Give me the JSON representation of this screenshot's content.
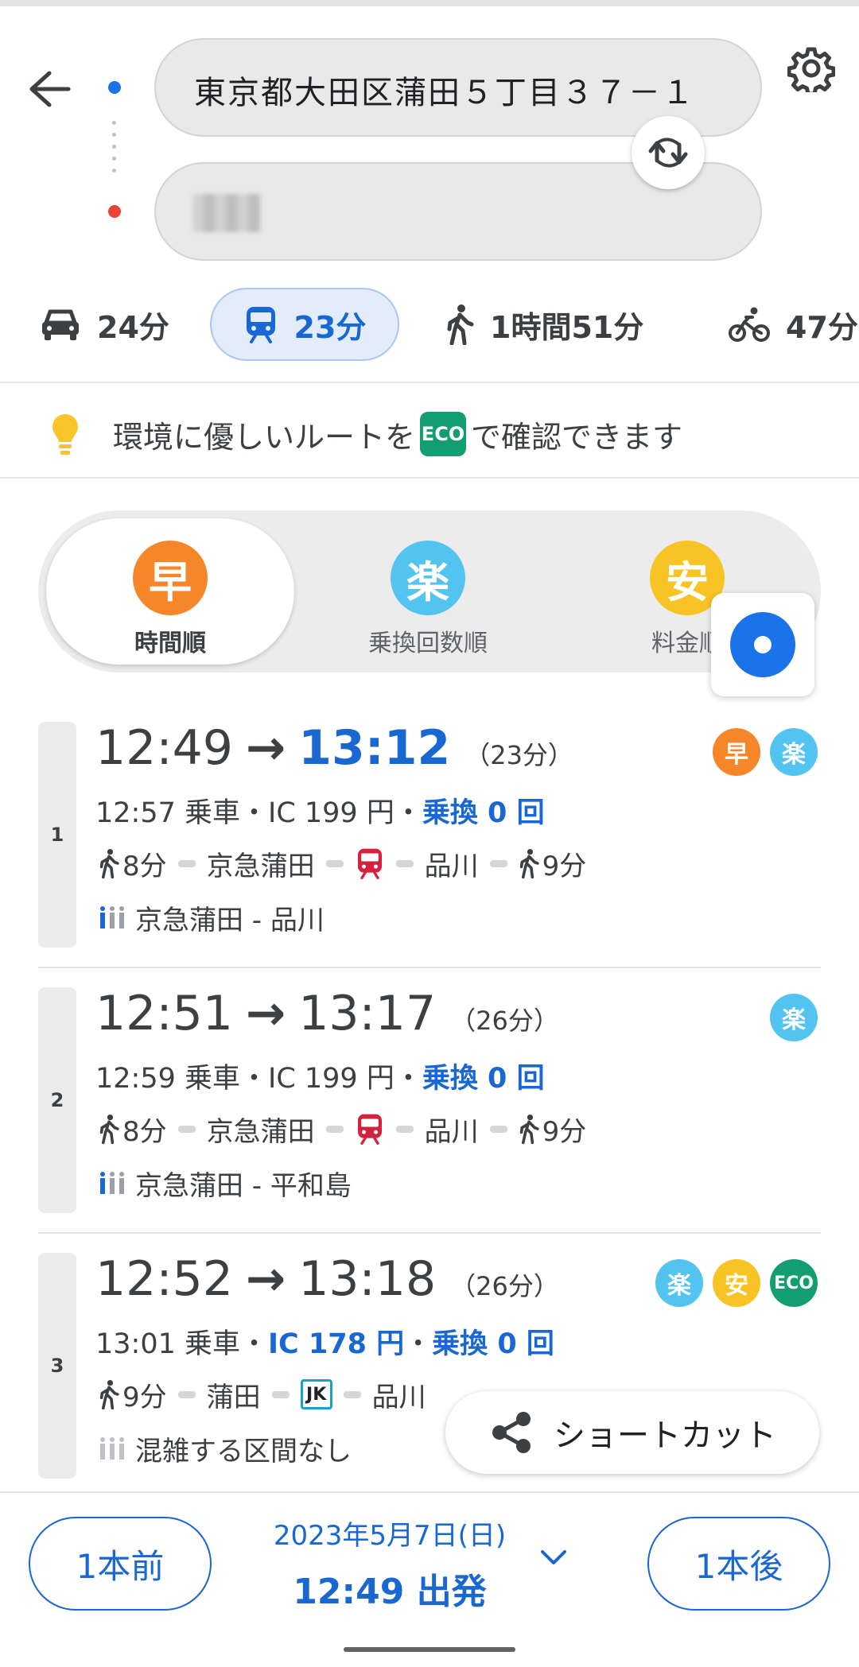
{
  "origin": {
    "value": "東京都大田区蒲田５丁目３７－１"
  },
  "destination": {
    "value": ""
  },
  "modes": {
    "car": "24分",
    "transit": "23分",
    "walk": "1時間51分",
    "bike": "47分"
  },
  "eco_banner": {
    "pre": "環境に優しいルートを",
    "chip": "ECO",
    "post": "で確認できます"
  },
  "sort": [
    {
      "icon": "早",
      "label": "時間順",
      "color": "#f5872a"
    },
    {
      "icon": "楽",
      "label": "乗換回数順",
      "color": "#53c3f0"
    },
    {
      "icon": "安",
      "label": "料金順",
      "color": "#f7c325"
    }
  ],
  "routes": [
    {
      "index": "1",
      "depart": "12:49",
      "arrive": "13:12",
      "duration": "（23分）",
      "board": "12:57 乗車・",
      "fare": "IC 199 円",
      "fare_highlight": false,
      "transfers": "乗換 0 回",
      "walk1": "8分",
      "station1": "京急蒲田",
      "line": "keikyu",
      "station2": "品川",
      "walk2": "9分",
      "crowd": "京急蒲田 - 品川",
      "badges": [
        "早",
        "楽"
      ]
    },
    {
      "index": "2",
      "depart": "12:51",
      "arrive": "13:17",
      "duration": "（26分）",
      "board": "12:59 乗車・",
      "fare": "IC 199 円",
      "fare_highlight": false,
      "transfers": "乗換 0 回",
      "walk1": "8分",
      "station1": "京急蒲田",
      "line": "keikyu",
      "station2": "品川",
      "walk2": "9分",
      "crowd": "京急蒲田 - 平和島",
      "badges": [
        "楽"
      ]
    },
    {
      "index": "3",
      "depart": "12:52",
      "arrive": "13:18",
      "duration": "（26分）",
      "board": "13:01 乗車・",
      "fare": "IC 178 円",
      "fare_highlight": true,
      "transfers": "乗換 0 回",
      "walk1": "9分",
      "station1": "蒲田",
      "line_code": "JK",
      "station2": "品川",
      "crowd": "混雑する区間なし",
      "badges": [
        "楽",
        "安",
        "ECO"
      ]
    }
  ],
  "separator": "・",
  "shortcut": {
    "label": "ショートカット"
  },
  "bottom": {
    "prev": "1本前",
    "next": "1本後",
    "date": "2023年5月7日(日)",
    "departure": "12:49 出発"
  },
  "colors": {
    "accent": "#1967d2",
    "eco": "#129e71",
    "keikyu": "#d4213d"
  }
}
